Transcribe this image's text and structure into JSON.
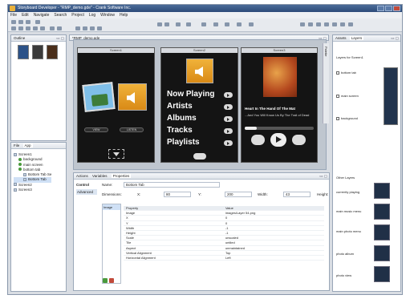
{
  "app": {
    "title": "Storyboard Developer - \"RMP_demo.gde\" - Crank Software Inc."
  },
  "menu": [
    "File",
    "Edit",
    "Navigate",
    "Search",
    "Project",
    "Log",
    "Window",
    "Help"
  ],
  "outline": {
    "tab": "Outline"
  },
  "app_tree": {
    "tabs": [
      "File",
      "App"
    ],
    "items": [
      "Screen1",
      "background",
      "main screen",
      "bottom tab",
      "Bottom Tab Se",
      "Bottom Tab",
      "Screen2",
      "Screen3"
    ]
  },
  "editor": {
    "tab": "*RMP_demo.gde",
    "screens": [
      "Screen1",
      "Screen2",
      "Screen3"
    ],
    "screen1": {
      "view_btn": "VIEW",
      "listen_btn": "LISTEN"
    },
    "screen2": {
      "menu": [
        "Now Playing",
        "Artists",
        "Albums",
        "Tracks",
        "Playlists"
      ]
    },
    "screen3": {
      "song": "Heart In The Hand Of The Mat",
      "sub": "...And You Will Know Us By The Trail of Dead"
    },
    "side_label": "Palette"
  },
  "bottom_tabs": [
    "Actions",
    "Variables",
    "Properties"
  ],
  "properties": {
    "control_label": "Control",
    "advanced_label": "Advanced",
    "name_label": "Name:",
    "name_value": "Bottom Tab",
    "dimensions_label": "Dimensions:",
    "x_label": "X:",
    "x_value": "80",
    "y_label": "Y:",
    "y_value": "200",
    "width_label": "Width:",
    "width_value": "43",
    "height_label": "Height:",
    "list_item": "Image",
    "table_header": [
      "Property",
      "Value"
    ],
    "rows": [
      [
        "Image",
        "images/Layer 54.png"
      ],
      [
        "X",
        "0"
      ],
      [
        "Y",
        "0"
      ],
      [
        "Width",
        "-1"
      ],
      [
        "Height",
        "-1"
      ],
      [
        "Scale",
        "unscaled"
      ],
      [
        "Tile",
        "untiled"
      ],
      [
        "Aspect",
        "unmaintained"
      ],
      [
        "Vertical Alignment",
        "Top"
      ],
      [
        "Horizontal Alignment",
        "Left"
      ]
    ]
  },
  "assets": {
    "tabs": [
      "Assets",
      "Layers"
    ],
    "title": "Layers for Screen1",
    "layers": [
      "bottom tab",
      "main screen",
      "background"
    ],
    "other_title": "Other Layers",
    "other": [
      "currently playing",
      "main music menu",
      "main photo menu",
      "photo album",
      "photo view"
    ]
  },
  "colors": {
    "accent": "#3b5c8c",
    "panel_border": "#9aa7b8"
  }
}
